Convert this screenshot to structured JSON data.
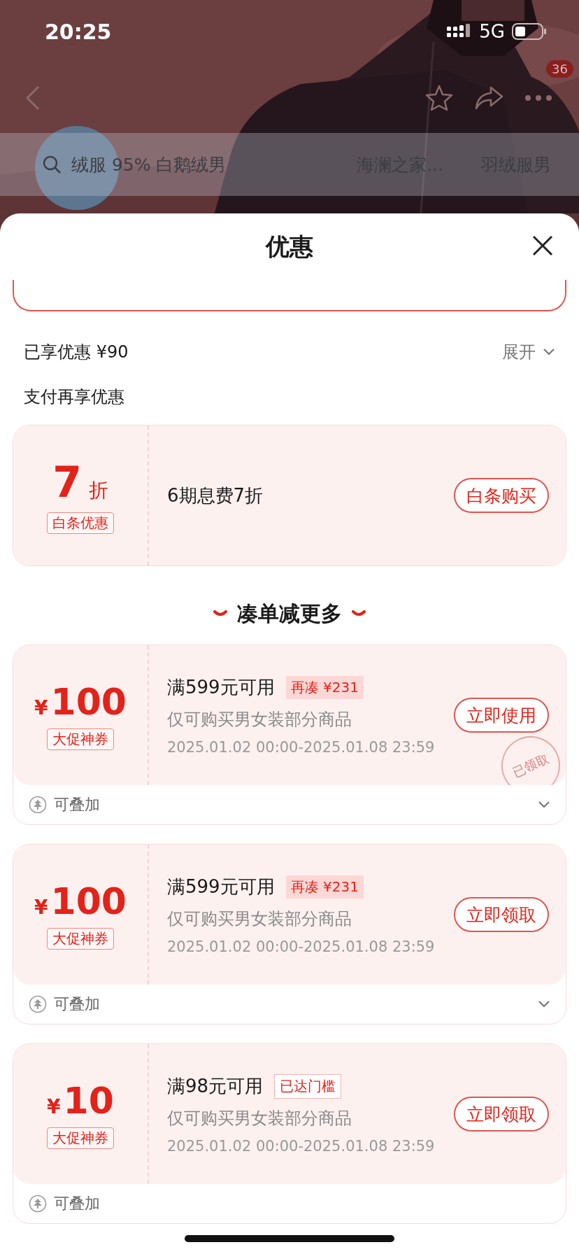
{
  "status_bar": {
    "time": "20:25",
    "network": "5G"
  },
  "nav": {
    "badge": "36"
  },
  "search": {
    "query": "绒服 95% 白鹅绒男",
    "tabs": [
      "海澜之家...",
      "羽绒服男"
    ]
  },
  "sheet": {
    "title": "优惠",
    "enjoyed": {
      "label": "已享优惠 ¥90",
      "toggle": "展开"
    },
    "pay_heading": "支付再享优惠",
    "pay_offer": {
      "value": "7",
      "unit": "折",
      "tag": "白条优惠",
      "desc": "6期息费7折",
      "button": "白条购买"
    },
    "section_title": "凑单减更多",
    "coupons": [
      {
        "currency": "¥",
        "amount": "100",
        "tag": "大促神券",
        "condition": "满599元可用",
        "hint": {
          "text": "再凑 ¥231",
          "kind": "shortfall"
        },
        "scope": "仅可购买男女装部分商品",
        "period": "2025.01.02 00:00-2025.01.08 23:59",
        "button": "立即使用",
        "claimed": true,
        "stamp": "已领取",
        "stack": "可叠加",
        "expandable": true
      },
      {
        "currency": "¥",
        "amount": "100",
        "tag": "大促神券",
        "condition": "满599元可用",
        "hint": {
          "text": "再凑 ¥231",
          "kind": "shortfall"
        },
        "scope": "仅可购买男女装部分商品",
        "period": "2025.01.02 00:00-2025.01.08 23:59",
        "button": "立即领取",
        "claimed": false,
        "stack": "可叠加",
        "expandable": true
      },
      {
        "currency": "¥",
        "amount": "10",
        "tag": "大促神券",
        "condition": "满98元可用",
        "hint": {
          "text": "已达门槛",
          "kind": "reached"
        },
        "scope": "仅可购买男女装部分商品",
        "period": "2025.01.02 00:00-2025.01.08 23:59",
        "button": "立即领取",
        "claimed": false,
        "stack": "可叠加",
        "expandable": false
      }
    ]
  }
}
